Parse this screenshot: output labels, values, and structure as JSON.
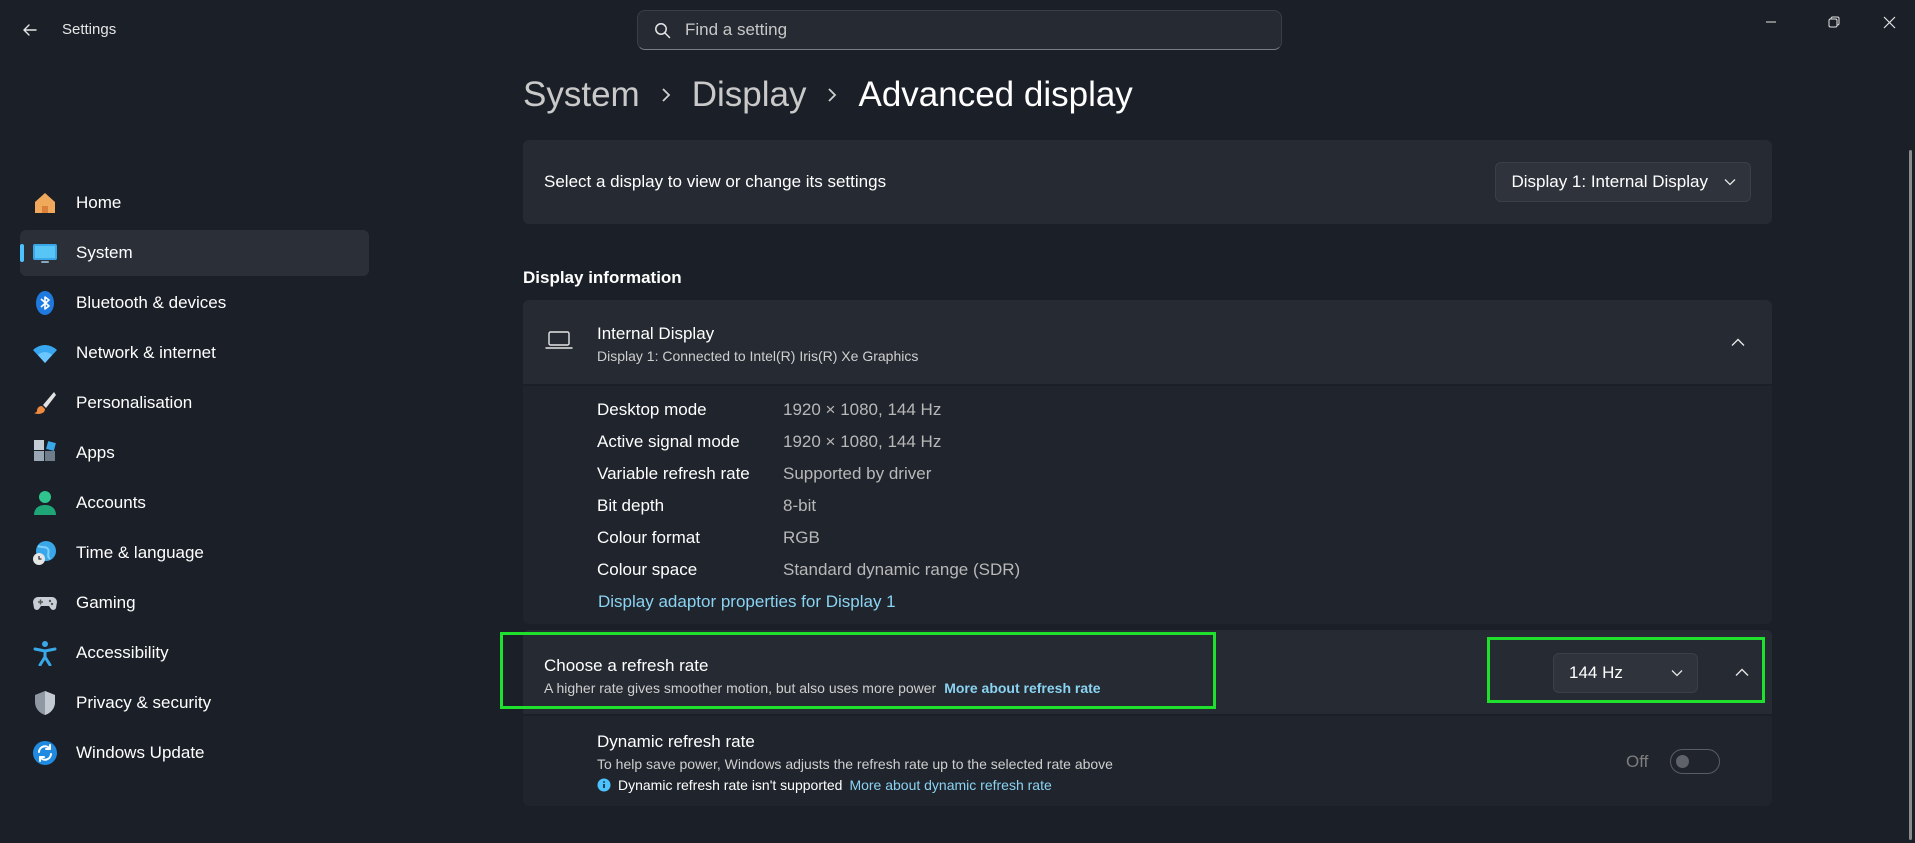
{
  "app": {
    "title": "Settings"
  },
  "search": {
    "placeholder": "Find a setting"
  },
  "sidebar": {
    "items": [
      {
        "label": "Home",
        "icon": "home-icon"
      },
      {
        "label": "System",
        "icon": "monitor-icon",
        "selected": true
      },
      {
        "label": "Bluetooth & devices",
        "icon": "bluetooth-icon"
      },
      {
        "label": "Network & internet",
        "icon": "wifi-icon"
      },
      {
        "label": "Personalisation",
        "icon": "paintbrush-icon"
      },
      {
        "label": "Apps",
        "icon": "apps-icon"
      },
      {
        "label": "Accounts",
        "icon": "person-icon"
      },
      {
        "label": "Time & language",
        "icon": "globe-clock-icon"
      },
      {
        "label": "Gaming",
        "icon": "gamepad-icon"
      },
      {
        "label": "Accessibility",
        "icon": "accessibility-icon"
      },
      {
        "label": "Privacy & security",
        "icon": "shield-icon"
      },
      {
        "label": "Windows Update",
        "icon": "update-icon"
      }
    ]
  },
  "breadcrumb": {
    "system": "System",
    "display": "Display",
    "current": "Advanced display"
  },
  "display_select": {
    "label": "Select a display to view or change its settings",
    "value": "Display 1: Internal Display"
  },
  "display_info": {
    "section_title": "Display information",
    "name": "Internal Display",
    "subtitle": "Display 1: Connected to Intel(R) Iris(R) Xe Graphics",
    "rows": [
      {
        "key": "Desktop mode",
        "value": "1920 × 1080, 144 Hz"
      },
      {
        "key": "Active signal mode",
        "value": "1920 × 1080, 144 Hz"
      },
      {
        "key": "Variable refresh rate",
        "value": "Supported by driver"
      },
      {
        "key": "Bit depth",
        "value": "8-bit"
      },
      {
        "key": "Colour format",
        "value": "RGB"
      },
      {
        "key": "Colour space",
        "value": "Standard dynamic range (SDR)"
      }
    ],
    "adapter_link": "Display adaptor properties for Display 1"
  },
  "refresh_rate": {
    "title": "Choose a refresh rate",
    "description": "A higher rate gives smoother motion, but also uses more power",
    "link": "More about refresh rate",
    "value": "144 Hz"
  },
  "dynamic_refresh": {
    "title": "Dynamic refresh rate",
    "description": "To help save power, Windows adjusts the refresh rate up to the selected rate above",
    "note": "Dynamic refresh rate isn't supported",
    "link": "More about dynamic refresh rate",
    "toggle_label": "Off"
  },
  "colors": {
    "accent": "#4cc2ff",
    "link": "#8ad3f2",
    "highlight": "#1fe12d",
    "background": "#1b1f27",
    "card": "#262a32"
  }
}
